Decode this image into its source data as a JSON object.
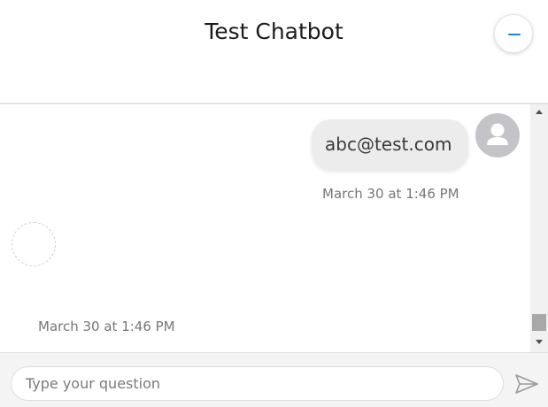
{
  "header": {
    "title": "Test Chatbot",
    "minimize_icon": "minus-icon"
  },
  "messages": [
    {
      "sender": "user",
      "text": "abc@test.com",
      "timestamp": "March 30 at 1:46 PM",
      "avatar_icon": "user-avatar-icon"
    },
    {
      "sender": "bot",
      "text": "",
      "timestamp": "March 30 at 1:46 PM",
      "avatar_icon": "bot-avatar-icon"
    }
  ],
  "input": {
    "value": "",
    "placeholder": "Type your question"
  },
  "send_icon": "send-icon",
  "colors": {
    "accent": "#1c87d6",
    "bubble": "#ececec",
    "avatar": "#c4c4c8",
    "timestamp": "#777777"
  }
}
